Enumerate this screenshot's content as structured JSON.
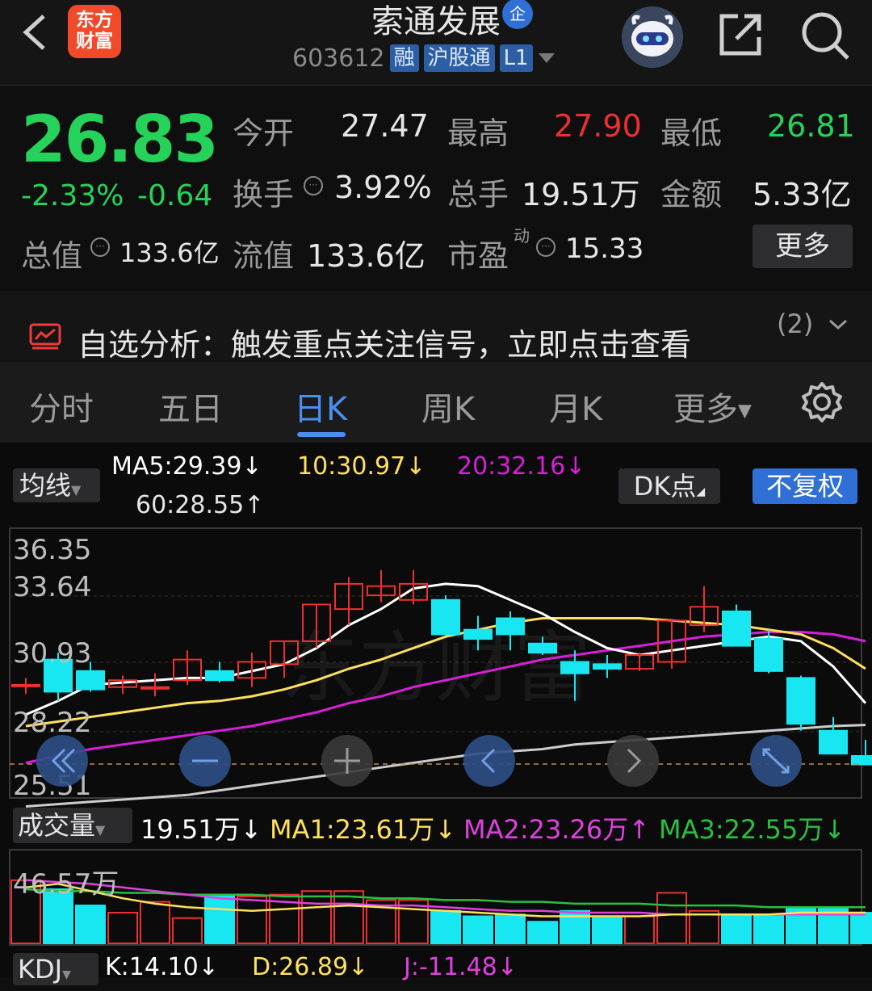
{
  "header": {
    "logo_line1": "东方",
    "logo_line2": "财富",
    "stock_name": "索通发展",
    "enterprise_badge": "企",
    "stock_code": "603612",
    "tags": [
      "融",
      "沪股通",
      "L1"
    ]
  },
  "quote": {
    "price": "26.83",
    "change_pct": "-2.33%",
    "change": "-0.64",
    "open_label": "今开",
    "open": "27.47",
    "high_label": "最高",
    "high": "27.90",
    "low_label": "最低",
    "low": "26.81",
    "turnover_label": "换手",
    "turnover": "3.92%",
    "volume_label": "总手",
    "volume": "19.51万",
    "amount_label": "金额",
    "amount": "5.33亿",
    "mktcap_label": "总值",
    "mktcap": "133.6亿",
    "float_label": "流值",
    "float": "133.6亿",
    "pe_label": "市盈",
    "pe_sup": "动",
    "pe": "15.33",
    "more_button": "更多"
  },
  "analysis": {
    "text": "自选分析：触发重点关注信号，立即点击查看",
    "count": "(2)"
  },
  "tabs": [
    "分时",
    "五日",
    "日K",
    "周K",
    "月K",
    "更多"
  ],
  "ma_bar": {
    "selector": "均线",
    "ma5": "MA5:29.39↓",
    "ma10": "10:30.97↓",
    "ma20": "20:32.16↓",
    "ma60": "60:28.55↑",
    "dk_button": "DK点",
    "adjust_button": "不复权"
  },
  "price_axis": [
    "36.35",
    "33.64",
    "30.93",
    "28.22",
    "25.51"
  ],
  "watermark": "东方财富",
  "volume_bar": {
    "selector": "成交量",
    "vol": "19.51万↓",
    "ma1": "MA1:23.61万↓",
    "ma2": "MA2:23.26万↑",
    "ma3": "MA3:22.55万↓",
    "axis_top": "46.57万"
  },
  "kdj_bar": {
    "selector": "KDJ",
    "k": "K:14.10↓",
    "d": "D:26.89↓",
    "j": "J:-11.48↓"
  },
  "colors": {
    "up": "#ee2f2f",
    "down": "#18e6f0",
    "ma5": "#ffffff",
    "ma10": "#ffe05a",
    "ma20": "#d81ed8",
    "ma60": "#cccccc",
    "accent": "#4a8ff0"
  },
  "chart_data": {
    "type": "candlestick",
    "ylim": [
      25.51,
      36.35
    ],
    "candles": [
      {
        "o": 30.3,
        "h": 30.6,
        "l": 29.9,
        "c": 30.3
      },
      {
        "o": 31.4,
        "h": 31.7,
        "l": 29.6,
        "c": 30.0
      },
      {
        "o": 30.9,
        "h": 31.3,
        "l": 30.0,
        "c": 30.1
      },
      {
        "o": 30.2,
        "h": 30.7,
        "l": 29.9,
        "c": 30.5
      },
      {
        "o": 30.2,
        "h": 30.8,
        "l": 29.8,
        "c": 30.2
      },
      {
        "o": 30.5,
        "h": 31.8,
        "l": 30.3,
        "c": 31.4
      },
      {
        "o": 30.9,
        "h": 31.3,
        "l": 30.4,
        "c": 30.5
      },
      {
        "o": 30.6,
        "h": 31.7,
        "l": 30.2,
        "c": 31.3
      },
      {
        "o": 31.2,
        "h": 32.2,
        "l": 30.6,
        "c": 32.2
      },
      {
        "o": 32.2,
        "h": 33.8,
        "l": 31.9,
        "c": 33.8
      },
      {
        "o": 33.6,
        "h": 35.0,
        "l": 32.9,
        "c": 34.7
      },
      {
        "o": 34.2,
        "h": 35.3,
        "l": 33.9,
        "c": 34.6
      },
      {
        "o": 34.0,
        "h": 35.3,
        "l": 33.8,
        "c": 34.7
      },
      {
        "o": 34.0,
        "h": 34.2,
        "l": 32.9,
        "c": 32.5
      },
      {
        "o": 32.7,
        "h": 33.3,
        "l": 31.8,
        "c": 32.3
      },
      {
        "o": 33.2,
        "h": 33.5,
        "l": 31.8,
        "c": 32.5
      },
      {
        "o": 32.1,
        "h": 32.4,
        "l": 31.6,
        "c": 31.7
      },
      {
        "o": 31.3,
        "h": 31.8,
        "l": 29.6,
        "c": 30.8
      },
      {
        "o": 31.2,
        "h": 31.6,
        "l": 30.6,
        "c": 31.0
      },
      {
        "o": 31.0,
        "h": 31.7,
        "l": 30.9,
        "c": 31.6
      },
      {
        "o": 31.3,
        "h": 33.1,
        "l": 31.0,
        "c": 33.1
      },
      {
        "o": 32.9,
        "h": 34.6,
        "l": 32.6,
        "c": 33.7
      },
      {
        "o": 33.5,
        "h": 33.8,
        "l": 32.1,
        "c": 32.0
      },
      {
        "o": 32.3,
        "h": 32.7,
        "l": 30.8,
        "c": 30.9
      },
      {
        "o": 30.6,
        "h": 30.7,
        "l": 28.3,
        "c": 28.6
      },
      {
        "o": 28.3,
        "h": 28.9,
        "l": 27.3,
        "c": 27.3
      },
      {
        "o": 27.2,
        "h": 27.9,
        "l": 26.81,
        "c": 26.83
      }
    ],
    "ma5": [
      29.0,
      29.6,
      30.3,
      30.4,
      30.5,
      30.6,
      30.6,
      30.9,
      31.2,
      31.9,
      32.9,
      33.6,
      34.5,
      34.7,
      34.6,
      34.0,
      33.4,
      32.6,
      31.9,
      31.6,
      31.8,
      32.0,
      32.2,
      32.4,
      32.2,
      31.1,
      29.5
    ],
    "ma10": [
      28.5,
      28.7,
      28.9,
      29.1,
      29.3,
      29.5,
      29.6,
      29.8,
      30.1,
      30.5,
      31.0,
      31.4,
      31.9,
      32.4,
      32.7,
      33.0,
      33.2,
      33.2,
      33.2,
      33.2,
      33.1,
      33.0,
      32.9,
      32.7,
      32.5,
      31.9,
      31.0
    ],
    "ma20": [
      26.9,
      27.2,
      27.5,
      27.7,
      27.9,
      28.1,
      28.3,
      28.5,
      28.8,
      29.1,
      29.5,
      29.8,
      30.2,
      30.5,
      30.8,
      31.1,
      31.4,
      31.6,
      31.8,
      32.0,
      32.2,
      32.4,
      32.5,
      32.6,
      32.6,
      32.5,
      32.2
    ],
    "ma60": [
      25.0,
      25.1,
      25.2,
      25.3,
      25.4,
      25.5,
      25.7,
      25.9,
      26.1,
      26.3,
      26.5,
      26.7,
      26.9,
      27.1,
      27.3,
      27.4,
      27.5,
      27.7,
      27.8,
      27.9,
      28.0,
      28.1,
      28.2,
      28.3,
      28.4,
      28.5,
      28.55
    ],
    "volumes": [
      35,
      30,
      21,
      17,
      23,
      14,
      26,
      26,
      27,
      29,
      29,
      24,
      24,
      18,
      15,
      16,
      12,
      18,
      14,
      15,
      28,
      18,
      15,
      16,
      20,
      19.51,
      17
    ],
    "vol_ma1": [
      31,
      33,
      29,
      25,
      22,
      20,
      19,
      18,
      19,
      20,
      21,
      20,
      19,
      18,
      17,
      16,
      15,
      15,
      15,
      15,
      16,
      16,
      16,
      16,
      17,
      17,
      17
    ],
    "vol_ma2": [
      35,
      34,
      33,
      31,
      29,
      27,
      25,
      24,
      23,
      22,
      22,
      21,
      21,
      20,
      19,
      18,
      18,
      17,
      17,
      17,
      16,
      16,
      16,
      16,
      16,
      16,
      16
    ],
    "vol_ma3": [
      30,
      29,
      29,
      28,
      28,
      27,
      27,
      27,
      26,
      26,
      26,
      25,
      25,
      24,
      24,
      23,
      23,
      22,
      22,
      22,
      21,
      21,
      21,
      20,
      20,
      20,
      20
    ],
    "vol_ylim": [
      0,
      46.57
    ]
  }
}
